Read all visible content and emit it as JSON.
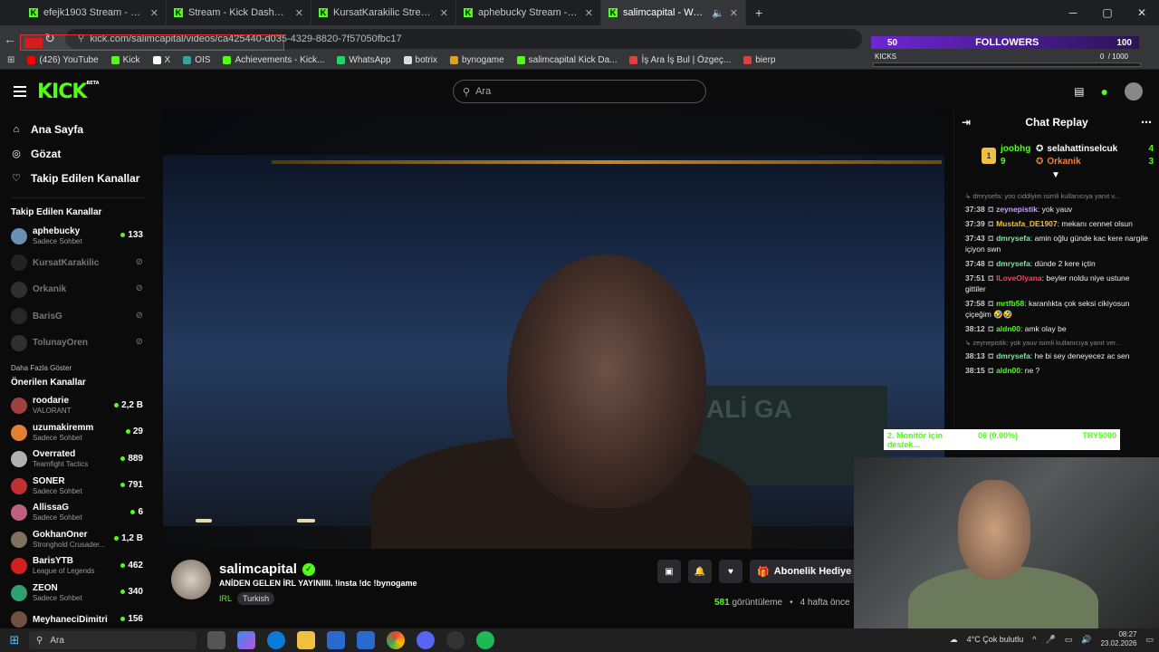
{
  "browser": {
    "tabs": [
      {
        "label": "efejk1903 Stream - Watch Live",
        "active": false
      },
      {
        "label": "Stream - Kick Dashboard",
        "active": false
      },
      {
        "label": "KursatKarakilic Stream - Watch",
        "active": false
      },
      {
        "label": "aphebucky Stream - Watch Live",
        "active": false
      },
      {
        "label": "salimcapital - Watch the VO",
        "active": true
      }
    ],
    "new_tab": "+",
    "url": "kick.com/salimcapital/videos/ca425440-d035-4329-8820-7f57050fbc17",
    "bookmarks": [
      {
        "label": "(426) YouTube",
        "color": "#ff0000"
      },
      {
        "label": "Kick",
        "color": "#53fc18"
      },
      {
        "label": "X",
        "color": "#ffffff"
      },
      {
        "label": "OIS",
        "color": "#3aa0a0"
      },
      {
        "label": "Achievements - Kick...",
        "color": "#53fc18"
      },
      {
        "label": "WhatsApp",
        "color": "#25d366"
      },
      {
        "label": "botrix",
        "color": "#dddddd"
      },
      {
        "label": "bynogame",
        "color": "#e0a020"
      },
      {
        "label": "salimcapital Kick Da...",
        "color": "#53fc18"
      },
      {
        "label": "İş Ara İş Bul | Özgeç...",
        "color": "#e04040"
      },
      {
        "label": "bierp",
        "color": "#e04040"
      }
    ]
  },
  "followers_overlay": {
    "current": "50",
    "label": "FOLLOWERS",
    "goal": "100"
  },
  "kicks_overlay": {
    "label": "KICKS",
    "value": "0",
    "goal": "/ 1000"
  },
  "kick": {
    "logo": "KICK",
    "logo_badge": "BETA",
    "search_placeholder": "Ara"
  },
  "sidebar": {
    "nav": [
      {
        "label": "Ana Sayfa",
        "icon": "home-icon"
      },
      {
        "label": "Gözat",
        "icon": "browse-icon"
      },
      {
        "label": "Takip Edilen Kanallar",
        "icon": "heart-icon"
      }
    ],
    "followed_title": "Takip Edilen Kanallar",
    "followed": [
      {
        "name": "aphebucky",
        "sub": "Sadece Sohbet",
        "viewers": "133",
        "live": true,
        "color": "#6a8fb0"
      },
      {
        "name": "KursatKarakilic",
        "sub": "",
        "viewers": "",
        "live": false,
        "color": "#3a3a3a"
      },
      {
        "name": "Orkanik",
        "sub": "",
        "viewers": "",
        "live": false,
        "color": "#555"
      },
      {
        "name": "BarisG",
        "sub": "",
        "viewers": "",
        "live": false,
        "color": "#444"
      },
      {
        "name": "TolunayOren",
        "sub": "",
        "viewers": "",
        "live": false,
        "color": "#555"
      }
    ],
    "show_more": "Daha Fazla Göster",
    "recommended_title": "Önerilen Kanallar",
    "recommended": [
      {
        "name": "roodarie",
        "sub": "VALORANT",
        "viewers": "2,2 B",
        "color": "#a04040"
      },
      {
        "name": "uzumakiremm",
        "sub": "Sadece Sohbet",
        "viewers": "29",
        "color": "#e08030"
      },
      {
        "name": "Overrated",
        "sub": "Teamfight Tactics",
        "viewers": "889",
        "color": "#b0b0b0"
      },
      {
        "name": "SONER",
        "sub": "Sadece Sohbet",
        "viewers": "791",
        "color": "#c03030"
      },
      {
        "name": "AllissaG",
        "sub": "Sadece Sohbet",
        "viewers": "6",
        "color": "#c06080"
      },
      {
        "name": "GokhanOner",
        "sub": "Stronghold Crusader...",
        "viewers": "1,2 B",
        "color": "#807060"
      },
      {
        "name": "BarisYTB",
        "sub": "League of Legends",
        "viewers": "462",
        "color": "#d02020"
      },
      {
        "name": "ZEON",
        "sub": "Sadece Sohbet",
        "viewers": "340",
        "color": "#30a070"
      },
      {
        "name": "MeyhaneciDimitri",
        "sub": "",
        "viewers": "156",
        "color": "#705040"
      }
    ]
  },
  "stream": {
    "channel": "salimcapital",
    "title": "ANİDEN GELEN İRL YAYINIIII. !insta !dc !bynogame",
    "category": "IRL",
    "tag": "Turkish",
    "views_count": "581",
    "views_label": "görüntüleme",
    "ago": "4 hafta önce",
    "subscribe_gift": "Abonelik Hediye Et",
    "sign_text": "ALİ GA"
  },
  "chat": {
    "title": "Chat Replay",
    "gifters": [
      {
        "rank": "1",
        "name": "joobhg",
        "count": "9"
      },
      {
        "name": "selahattinselcuk",
        "count": "4"
      },
      {
        "name": "Orkanik",
        "count": "3"
      }
    ],
    "messages": [
      {
        "reply": "dmrysefa: yoo ciddiyim isimli kullanıcıya yanıt v..."
      },
      {
        "time": "37:38",
        "user": "zeynepistik",
        "color": "#c8a0ff",
        "text": "yok yauv"
      },
      {
        "time": "37:39",
        "user": "Mustafa_DE1907",
        "color": "#f0c040",
        "text": "mekanı cennet olsun"
      },
      {
        "time": "37:43",
        "user": "dmrysefa",
        "color": "#7fe6a0",
        "text": "amin oğlu günde kac kere nargile içiyon swn"
      },
      {
        "time": "37:48",
        "user": "dmrysefa",
        "color": "#7fe6a0",
        "text": "dünde 2 kere içtin"
      },
      {
        "time": "37:51",
        "user": "ILoveOlyana",
        "color": "#ff4060",
        "text": "beyler noldu niye ustune gittiler"
      },
      {
        "time": "37:58",
        "user": "mrtfb58",
        "color": "#53fc18",
        "text": "karanlıkta çok seksi cikiyosun çiçeğim 🤣🤣"
      },
      {
        "time": "38:12",
        "user": "aldn00",
        "color": "#53fc18",
        "text": "amk olay be"
      },
      {
        "reply": "zeynepistik: yok yauv isimli kullanıcıya yanıt ver..."
      },
      {
        "time": "38:13",
        "user": "dmrysefa",
        "color": "#7fe6a0",
        "text": "he bi sey deneyecez ac sen"
      },
      {
        "time": "38:15",
        "user": "aldn00",
        "color": "#53fc18",
        "text": "ne ?"
      }
    ]
  },
  "donation_overlay": {
    "goal": "2. Monitör için destek...",
    "progress": "06 (0.00%)",
    "target": "TRY5000"
  },
  "taskbar": {
    "search": "Ara",
    "weather": "4°C  Çok bulutlu",
    "time": "08:27",
    "date": "23.02.2026"
  }
}
